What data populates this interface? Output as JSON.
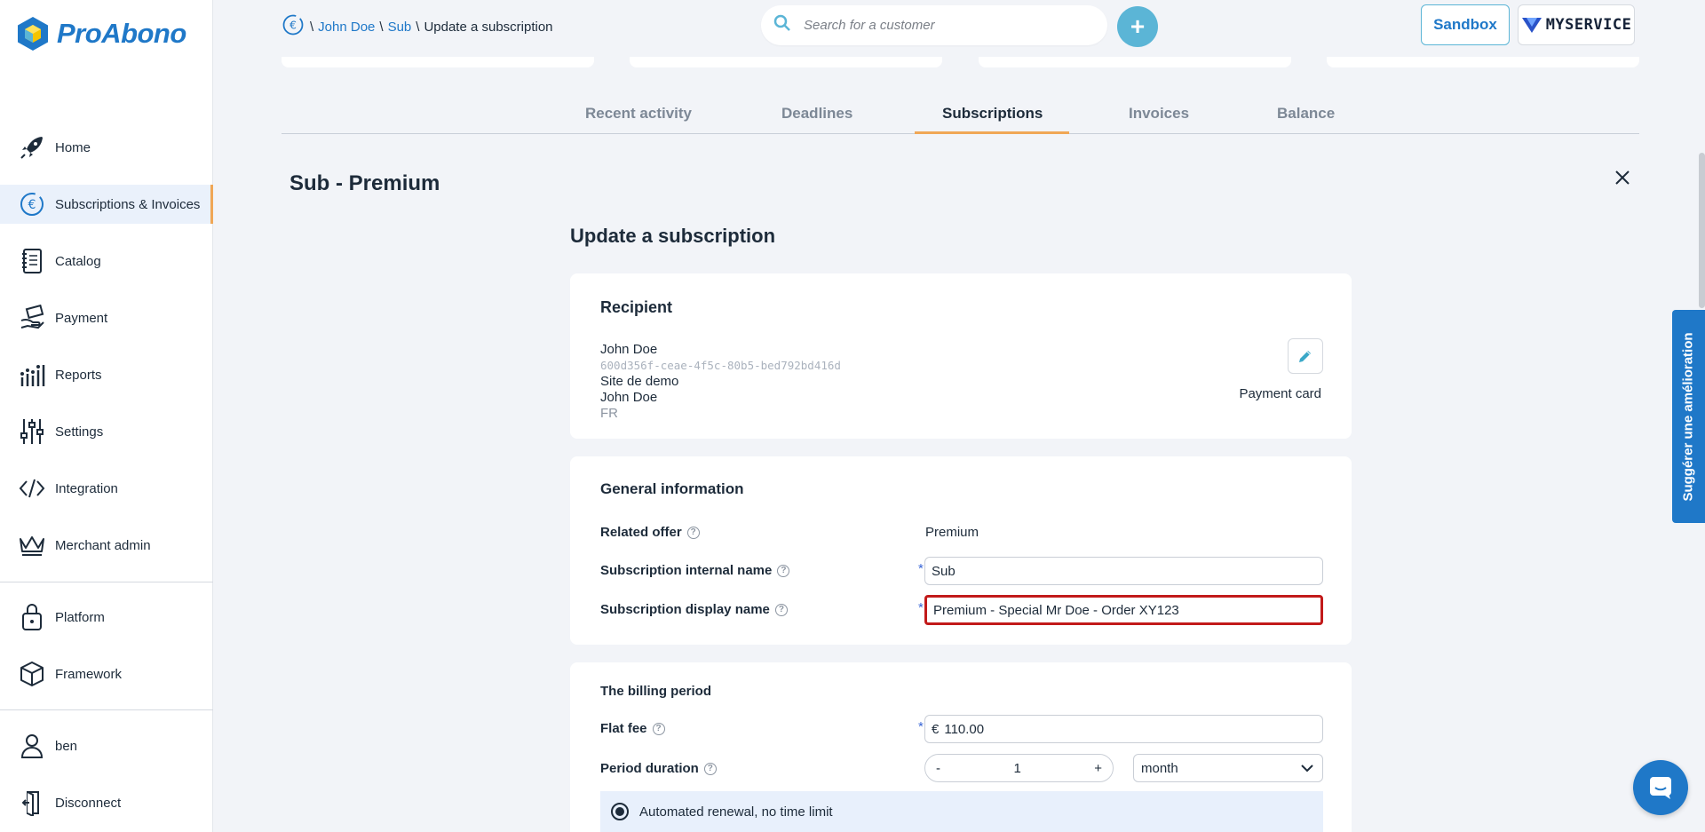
{
  "app": {
    "brand": "ProAbono",
    "merchant_logo": "MYSERVICE",
    "sandbox_label": "Sandbox"
  },
  "sidebar": {
    "items": [
      {
        "label": "Home",
        "icon": "rocket-icon"
      },
      {
        "label": "Subscriptions & Invoices",
        "icon": "euro-cycle-icon",
        "active": true
      },
      {
        "label": "Catalog",
        "icon": "notebook-icon"
      },
      {
        "label": "Payment",
        "icon": "hand-money-icon"
      },
      {
        "label": "Reports",
        "icon": "chart-icon"
      },
      {
        "label": "Settings",
        "icon": "sliders-icon"
      },
      {
        "label": "Integration",
        "icon": "code-icon"
      },
      {
        "label": "Merchant admin",
        "icon": "crown-icon"
      },
      {
        "label": "Platform",
        "icon": "lock-icon"
      },
      {
        "label": "Framework",
        "icon": "cube-icon"
      },
      {
        "label": "ben",
        "icon": "user-icon"
      },
      {
        "label": "Disconnect",
        "icon": "door-icon"
      }
    ]
  },
  "breadcrumb": {
    "customer": "John Doe",
    "subscription": "Sub",
    "current": "Update a subscription"
  },
  "search": {
    "placeholder": "Search for a customer"
  },
  "tabs": [
    {
      "label": "Recent activity"
    },
    {
      "label": "Deadlines"
    },
    {
      "label": "Subscriptions",
      "active": true
    },
    {
      "label": "Invoices"
    },
    {
      "label": "Balance"
    }
  ],
  "page": {
    "title": "Sub - Premium",
    "section_title": "Update a subscription"
  },
  "recipient": {
    "title": "Recipient",
    "name": "John Doe",
    "id": "600d356f-ceae-4f5c-80b5-bed792bd416d",
    "site": "Site de demo",
    "contact": "John Doe",
    "country": "FR",
    "payment_method": "Payment card"
  },
  "general": {
    "title": "General information",
    "related_offer_label": "Related offer",
    "related_offer_value": "Premium",
    "internal_name_label": "Subscription internal name",
    "internal_name_value": "Sub",
    "display_name_label": "Subscription display name",
    "display_name_value": "Premium - Special Mr Doe - Order XY123",
    "required_mark": "*"
  },
  "billing": {
    "title": "The billing period",
    "flat_fee_label": "Flat fee",
    "currency": "€",
    "flat_fee_value": "110.00",
    "period_label": "Period duration",
    "period_minus": "-",
    "period_value": "1",
    "period_plus": "+",
    "period_unit": "month",
    "renewal_option": "Automated renewal, no time limit"
  },
  "feedback": {
    "suggest_label": "Suggérer une amélioration"
  },
  "colors": {
    "accent": "#1f78c8",
    "tab_underline": "#f0a756",
    "highlight": "#c21a1a"
  }
}
